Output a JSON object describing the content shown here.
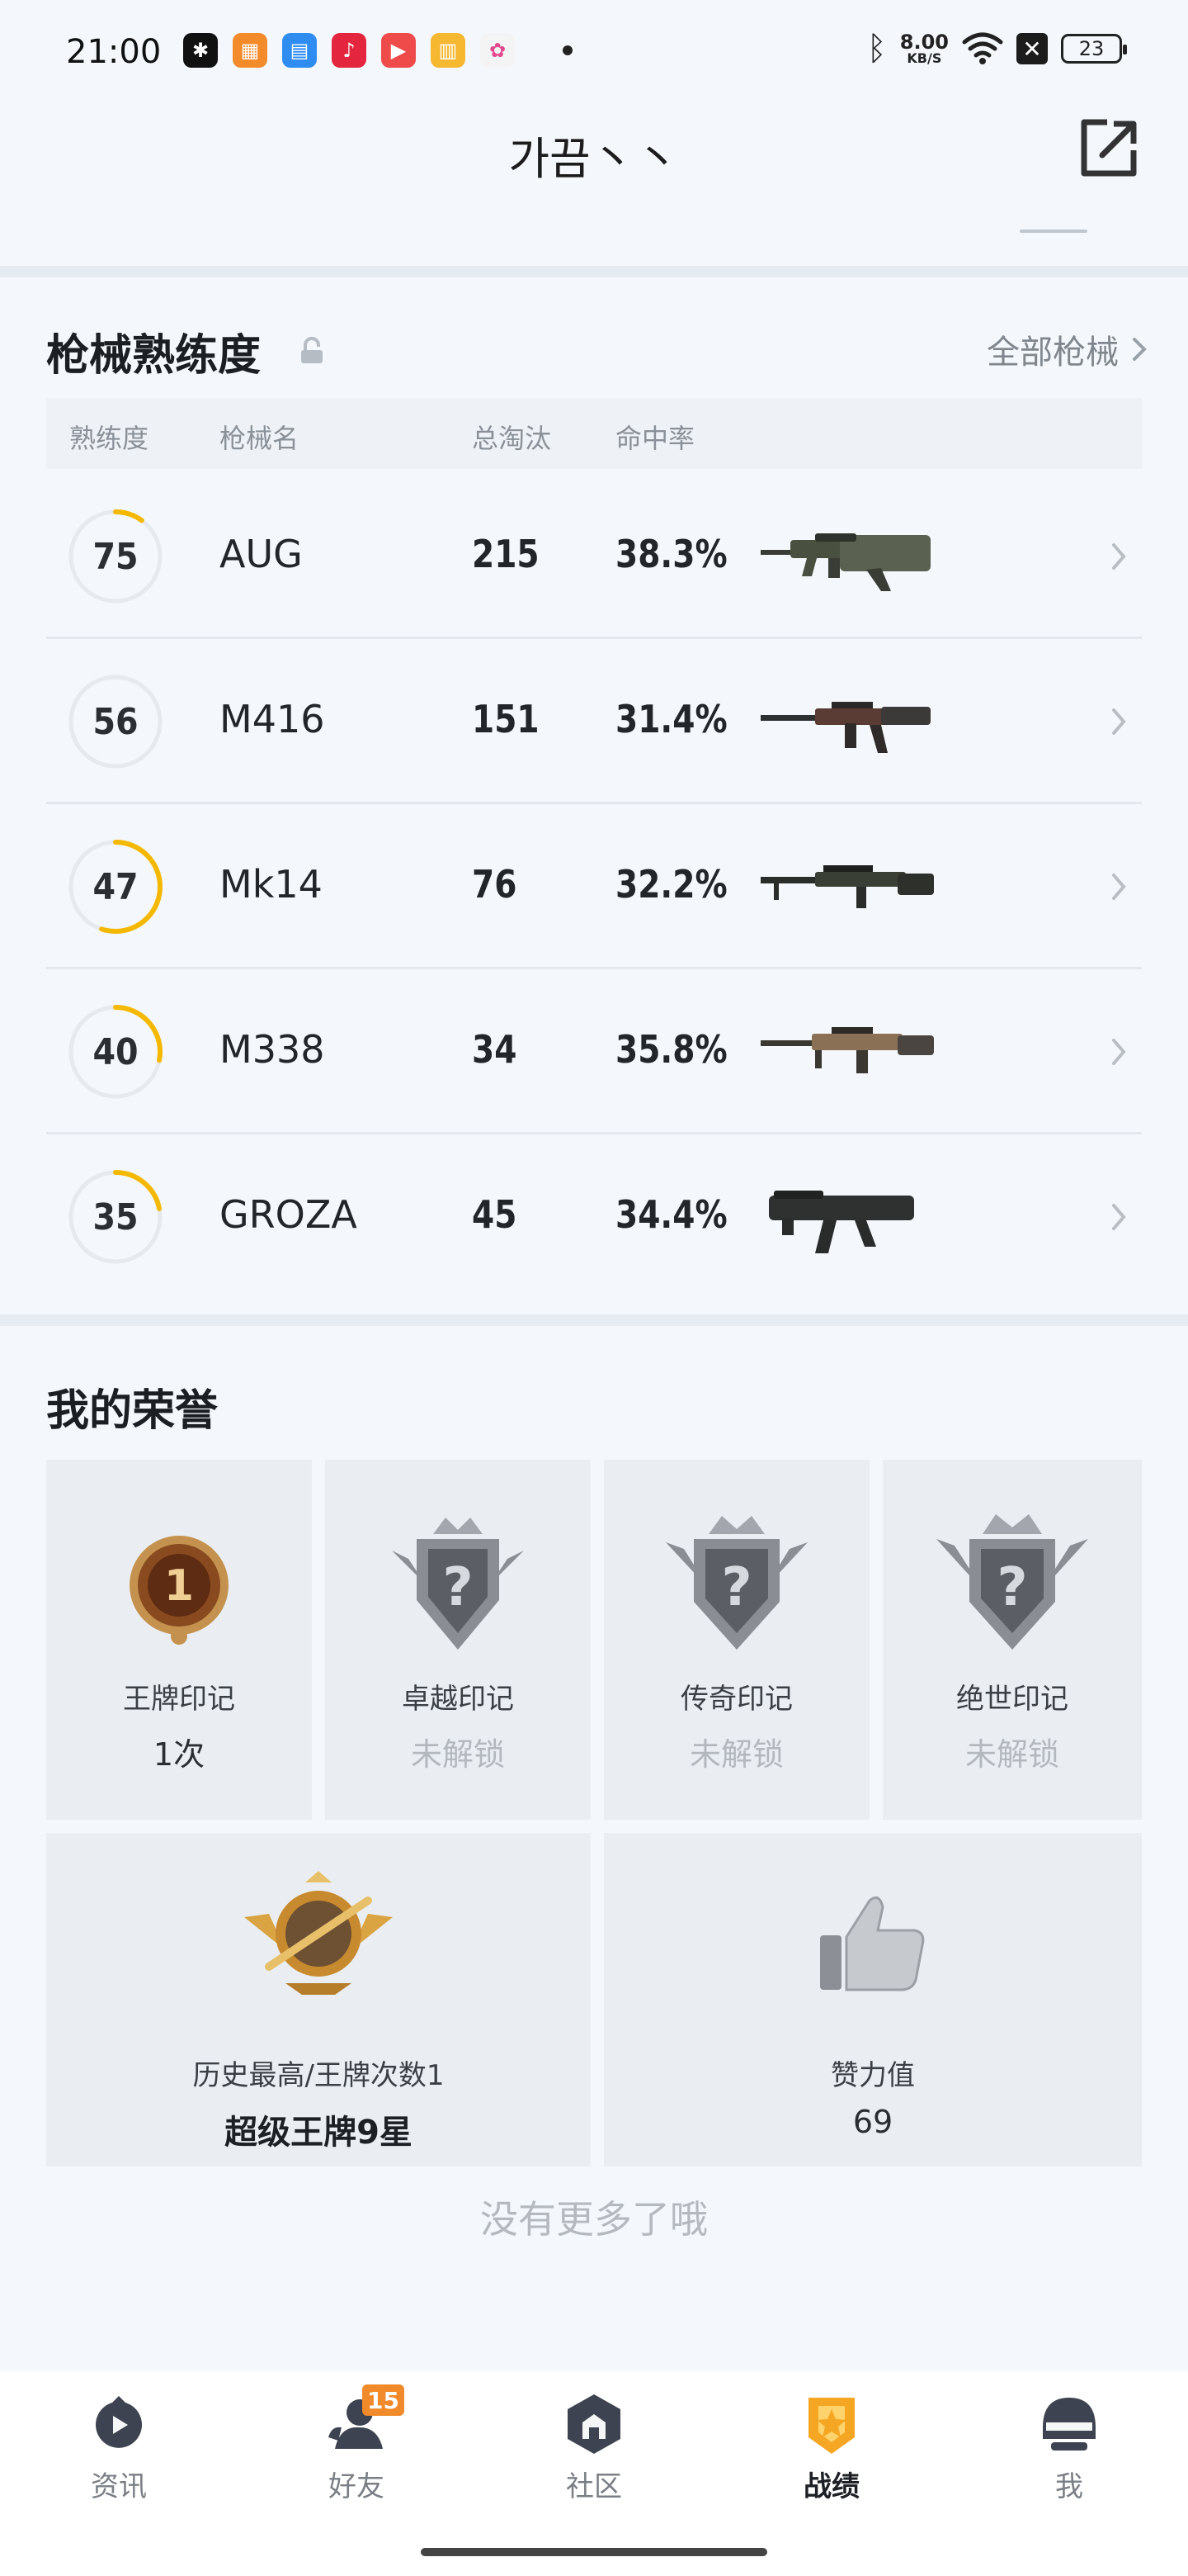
{
  "status_bar": {
    "time": "21:00",
    "net_speed_value": "8.00",
    "net_speed_unit": "KB/S",
    "battery": "23"
  },
  "header": {
    "title": "가끔丶丶"
  },
  "weapons": {
    "title": "枪械熟练度",
    "all_link": "全部枪械",
    "columns": [
      "熟练度",
      "枪械名",
      "总淘汰",
      "命中率"
    ],
    "rows": [
      {
        "proficiency": "75",
        "name": "AUG",
        "kills": "215",
        "accuracy": "38.3%",
        "progress": 0.1
      },
      {
        "proficiency": "56",
        "name": "M416",
        "kills": "151",
        "accuracy": "31.4%",
        "progress": 0.0
      },
      {
        "proficiency": "47",
        "name": "Mk14",
        "kills": "76",
        "accuracy": "32.2%",
        "progress": 0.55
      },
      {
        "proficiency": "40",
        "name": "M338",
        "kills": "34",
        "accuracy": "35.8%",
        "progress": 0.28
      },
      {
        "proficiency": "35",
        "name": "GROZA",
        "kills": "45",
        "accuracy": "34.4%",
        "progress": 0.22
      }
    ]
  },
  "honors": {
    "title": "我的荣誉",
    "marks": [
      {
        "label": "王牌印记",
        "value": "1次"
      },
      {
        "label": "卓越印记",
        "value": "未解锁"
      },
      {
        "label": "传奇印记",
        "value": "未解锁"
      },
      {
        "label": "绝世印记",
        "value": "未解锁"
      }
    ],
    "best": {
      "label": "历史最高/王牌次数1",
      "value": "超级王牌9星"
    },
    "likes": {
      "label": "赞力值",
      "value": "69"
    },
    "end_text": "没有更多了哦"
  },
  "nav": {
    "items": [
      {
        "label": "资讯"
      },
      {
        "label": "好友",
        "badge": "15"
      },
      {
        "label": "社区"
      },
      {
        "label": "战绩"
      },
      {
        "label": "我"
      }
    ],
    "active_color": "#f5a623"
  },
  "colors": {
    "accent": "#f5b800",
    "ring_track": "#e6e9ee"
  }
}
